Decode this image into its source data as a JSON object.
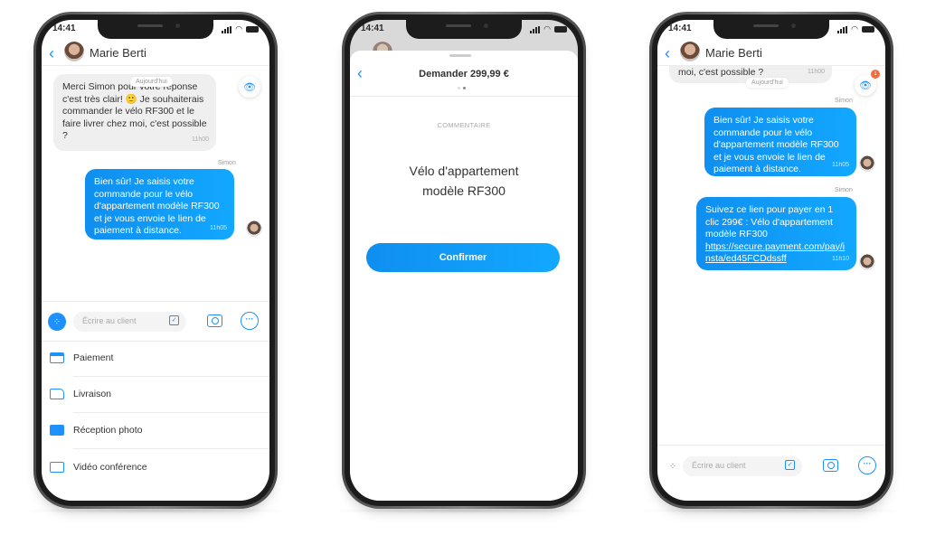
{
  "status_time": "14:41",
  "contact_name": "Marie Berti",
  "date_pill": "Aujourd'hui",
  "sender": "Simon",
  "badge_count": "1",
  "colors": {
    "accent": "#1e90ff",
    "badge": "#f26b3a"
  },
  "messages": {
    "incoming": {
      "text": "Merci Simon pour votre réponse c'est très clair! 🙂 Je souhaiterais commander le vélo RF300 et le faire livrer chez moi, c'est possible ?",
      "time": "11h00",
      "clipped_text": "moi, c'est possible ?"
    },
    "reply1": {
      "text": "Bien sûr! Je saisis votre commande pour le vélo d'appartement modèle RF300 et je vous envoie le lien de paiement à distance.",
      "time": "11h05"
    },
    "reply2": {
      "text": "Suivez ce lien pour payer en 1 clic 299€ : Vélo d'appartement modèle RF300",
      "link": "https://secure.payment.com/pay/insta/ed45FCDdssff",
      "time": "11h10"
    }
  },
  "composer": {
    "placeholder": "Écrire au client"
  },
  "menu": [
    {
      "label": "Paiement",
      "icon": "credit-card-icon"
    },
    {
      "label": "Livraison",
      "icon": "truck-icon"
    },
    {
      "label": "Réception photo",
      "icon": "photo-icon"
    },
    {
      "label": "Vidéo conférence",
      "icon": "video-icon"
    }
  ],
  "sheet": {
    "title": "Demander 299,99 €",
    "section_label": "COMMENTAIRE",
    "comment_line1": "Vélo d'appartement",
    "comment_line2": "modèle RF300",
    "confirm_label": "Confirmer"
  }
}
